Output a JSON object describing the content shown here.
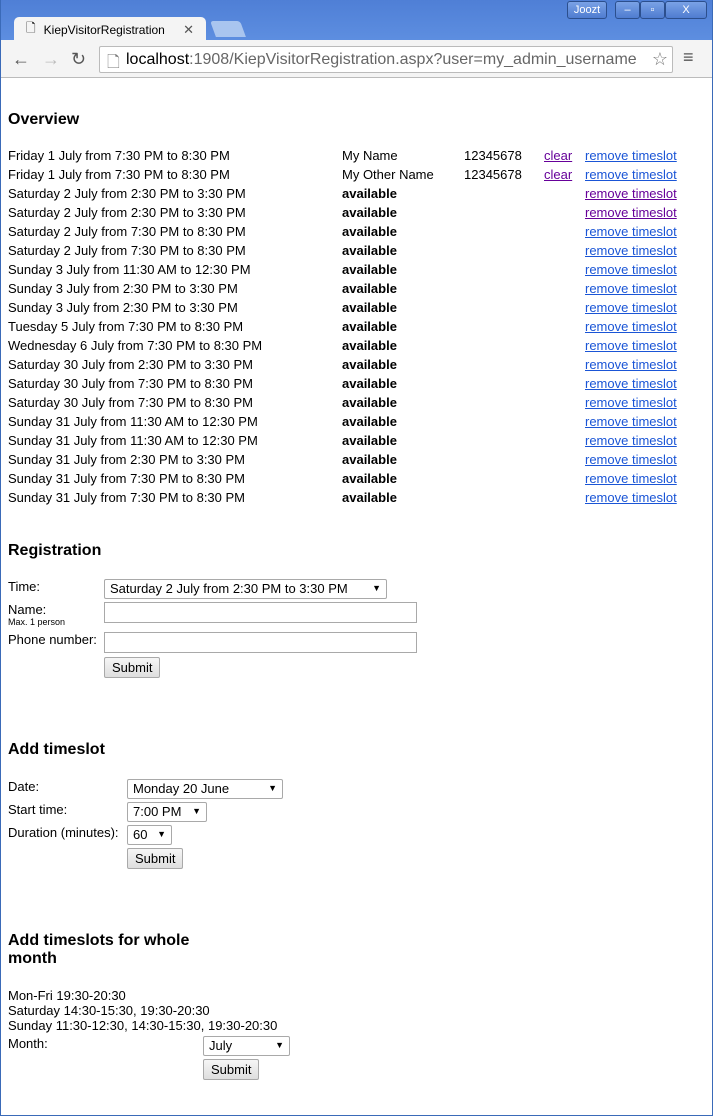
{
  "browser": {
    "tab_title": "KiepVisitorRegistration",
    "user": "Joozt",
    "url_host": "localhost",
    "url_rest": ":1908/KiepVisitorRegistration.aspx?user=my_admin_username"
  },
  "overview": {
    "title": "Overview",
    "clear_label": "clear",
    "remove_label": "remove timeslot",
    "rows": [
      {
        "slot": "Friday 1 July from 7:30 PM to 8:30 PM",
        "name": "My Name",
        "phone": "12345678",
        "clear": true,
        "visited": false
      },
      {
        "slot": "Friday 1 July from 7:30 PM to 8:30 PM",
        "name": "My Other Name",
        "phone": "12345678",
        "clear": true,
        "visited": false
      },
      {
        "slot": "Saturday 2 July from 2:30 PM to 3:30 PM",
        "name": "available",
        "phone": "",
        "clear": false,
        "visited": true
      },
      {
        "slot": "Saturday 2 July from 2:30 PM to 3:30 PM",
        "name": "available",
        "phone": "",
        "clear": false,
        "visited": true
      },
      {
        "slot": "Saturday 2 July from 7:30 PM to 8:30 PM",
        "name": "available",
        "phone": "",
        "clear": false,
        "visited": false
      },
      {
        "slot": "Saturday 2 July from 7:30 PM to 8:30 PM",
        "name": "available",
        "phone": "",
        "clear": false,
        "visited": false
      },
      {
        "slot": "Sunday 3 July from 11:30 AM to 12:30 PM",
        "name": "available",
        "phone": "",
        "clear": false,
        "visited": false
      },
      {
        "slot": "Sunday 3 July from 2:30 PM to 3:30 PM",
        "name": "available",
        "phone": "",
        "clear": false,
        "visited": false
      },
      {
        "slot": "Sunday 3 July from 2:30 PM to 3:30 PM",
        "name": "available",
        "phone": "",
        "clear": false,
        "visited": false
      },
      {
        "slot": "Tuesday 5 July from 7:30 PM to 8:30 PM",
        "name": "available",
        "phone": "",
        "clear": false,
        "visited": false
      },
      {
        "slot": "Wednesday 6 July from 7:30 PM to 8:30 PM",
        "name": "available",
        "phone": "",
        "clear": false,
        "visited": false
      },
      {
        "slot": "Saturday 30 July from 2:30 PM to 3:30 PM",
        "name": "available",
        "phone": "",
        "clear": false,
        "visited": false
      },
      {
        "slot": "Saturday 30 July from 7:30 PM to 8:30 PM",
        "name": "available",
        "phone": "",
        "clear": false,
        "visited": false
      },
      {
        "slot": "Saturday 30 July from 7:30 PM to 8:30 PM",
        "name": "available",
        "phone": "",
        "clear": false,
        "visited": false
      },
      {
        "slot": "Sunday 31 July from 11:30 AM to 12:30 PM",
        "name": "available",
        "phone": "",
        "clear": false,
        "visited": false
      },
      {
        "slot": "Sunday 31 July from 11:30 AM to 12:30 PM",
        "name": "available",
        "phone": "",
        "clear": false,
        "visited": false
      },
      {
        "slot": "Sunday 31 July from 2:30 PM to 3:30 PM",
        "name": "available",
        "phone": "",
        "clear": false,
        "visited": false
      },
      {
        "slot": "Sunday 31 July from 7:30 PM to 8:30 PM",
        "name": "available",
        "phone": "",
        "clear": false,
        "visited": false
      },
      {
        "slot": "Sunday 31 July from 7:30 PM to 8:30 PM",
        "name": "available",
        "phone": "",
        "clear": false,
        "visited": false
      }
    ]
  },
  "registration": {
    "title": "Registration",
    "time_label": "Time:",
    "time_value": "Saturday 2 July from 2:30 PM to 3:30 PM",
    "name_label": "Name:",
    "name_hint": "Max. 1 person",
    "name_value": "",
    "phone_label": "Phone number:",
    "phone_value": "",
    "submit": "Submit"
  },
  "add_timeslot": {
    "title": "Add timeslot",
    "date_label": "Date:",
    "date_value": "Monday 20 June",
    "start_label": "Start time:",
    "start_value": "7:00 PM",
    "duration_label": "Duration (minutes):",
    "duration_value": "60",
    "submit": "Submit"
  },
  "month": {
    "title": "Add timeslots for whole month",
    "lines": [
      "Mon-Fri 19:30-20:30",
      "Saturday 14:30-15:30, 19:30-20:30",
      "Sunday 11:30-12:30, 14:30-15:30, 19:30-20:30"
    ],
    "month_label": "Month:",
    "month_value": "July",
    "submit": "Submit"
  }
}
